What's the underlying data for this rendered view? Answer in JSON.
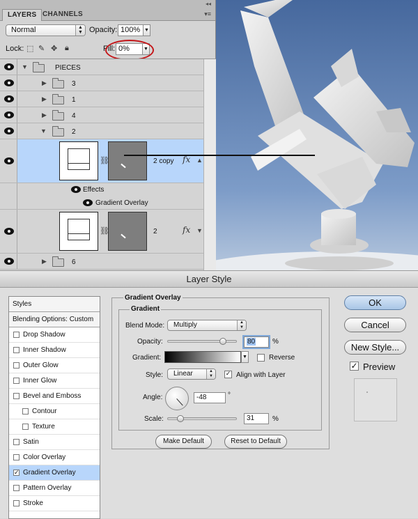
{
  "layers_panel": {
    "tabs": [
      "LAYERS",
      "CHANNELS"
    ],
    "blend_mode": "Normal",
    "opacity_label": "Opacity:",
    "opacity_value": "100%",
    "lock_label": "Lock:",
    "fill_label": "Fill:",
    "fill_value": "0%",
    "layers": [
      {
        "name": "PIECES",
        "type": "group",
        "expanded": true
      },
      {
        "name": "3",
        "type": "group",
        "expanded": false
      },
      {
        "name": "1",
        "type": "group",
        "expanded": false
      },
      {
        "name": "4",
        "type": "group",
        "expanded": false
      },
      {
        "name": "2",
        "type": "group",
        "expanded": true
      },
      {
        "name": "2 copy",
        "type": "layer",
        "selected": true,
        "has_fx": true
      },
      {
        "name": "Effects",
        "type": "effects"
      },
      {
        "name": "Gradient Overlay",
        "type": "effect"
      },
      {
        "name": "2",
        "type": "layer",
        "has_fx": true
      },
      {
        "name": "6",
        "type": "group",
        "expanded": false
      }
    ]
  },
  "dialog": {
    "title": "Layer Style",
    "styles_list": [
      {
        "label": "Styles",
        "kind": "header"
      },
      {
        "label": "Blending Options: Custom",
        "kind": "header"
      },
      {
        "label": "Drop Shadow",
        "checked": false
      },
      {
        "label": "Inner Shadow",
        "checked": false
      },
      {
        "label": "Outer Glow",
        "checked": false
      },
      {
        "label": "Inner Glow",
        "checked": false
      },
      {
        "label": "Bevel and Emboss",
        "checked": false
      },
      {
        "label": "Contour",
        "checked": false,
        "sub": true
      },
      {
        "label": "Texture",
        "checked": false,
        "sub": true
      },
      {
        "label": "Satin",
        "checked": false
      },
      {
        "label": "Color Overlay",
        "checked": false
      },
      {
        "label": "Gradient Overlay",
        "checked": true,
        "active": true
      },
      {
        "label": "Pattern Overlay",
        "checked": false
      },
      {
        "label": "Stroke",
        "checked": false
      }
    ],
    "section_title": "Gradient Overlay",
    "subsection_title": "Gradient",
    "blend_mode_label": "Blend Mode:",
    "blend_mode_value": "Multiply",
    "opacity_label": "Opacity:",
    "opacity_value": "80",
    "opacity_level": 0.8,
    "percent_sign": "%",
    "gradient_label": "Gradient:",
    "reverse_label": "Reverse",
    "reverse_checked": false,
    "style_label": "Style:",
    "style_value": "Linear",
    "align_label": "Align with Layer",
    "align_checked": true,
    "angle_label": "Angle:",
    "angle_value": "-48",
    "degree_sign": "°",
    "scale_label": "Scale:",
    "scale_value": "31",
    "scale_level": 0.31,
    "make_default": "Make Default",
    "reset_default": "Reset to Default",
    "ok": "OK",
    "cancel": "Cancel",
    "new_style": "New Style...",
    "preview_label": "Preview",
    "preview_checked": true
  },
  "colors": {
    "selection": "#b8d6fb",
    "sky_top": "#4b6fa3",
    "sky_bottom": "#9bb3d4",
    "highlight_ellipse": "#c4171a"
  }
}
